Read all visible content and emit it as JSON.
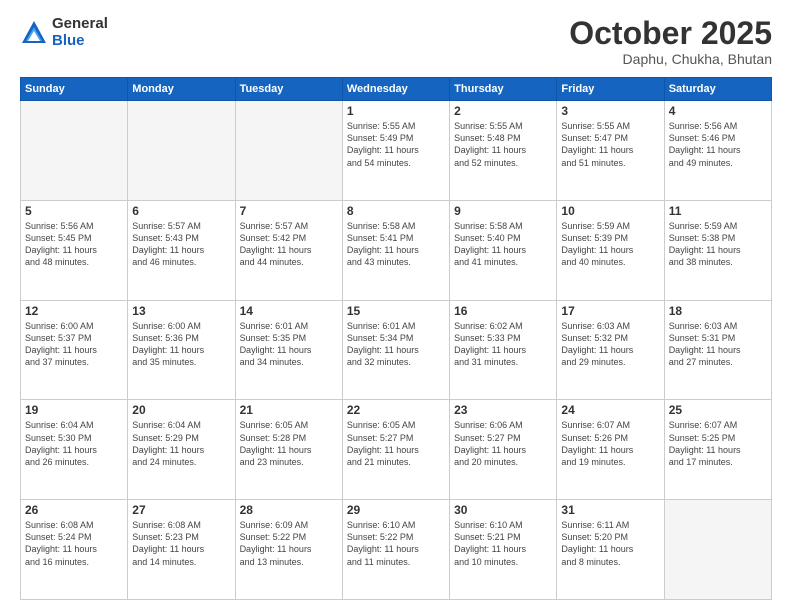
{
  "header": {
    "logo_general": "General",
    "logo_blue": "Blue",
    "title": "October 2025",
    "subtitle": "Daphu, Chukha, Bhutan"
  },
  "weekdays": [
    "Sunday",
    "Monday",
    "Tuesday",
    "Wednesday",
    "Thursday",
    "Friday",
    "Saturday"
  ],
  "weeks": [
    [
      {
        "day": "",
        "info": ""
      },
      {
        "day": "",
        "info": ""
      },
      {
        "day": "",
        "info": ""
      },
      {
        "day": "1",
        "info": "Sunrise: 5:55 AM\nSunset: 5:49 PM\nDaylight: 11 hours\nand 54 minutes."
      },
      {
        "day": "2",
        "info": "Sunrise: 5:55 AM\nSunset: 5:48 PM\nDaylight: 11 hours\nand 52 minutes."
      },
      {
        "day": "3",
        "info": "Sunrise: 5:55 AM\nSunset: 5:47 PM\nDaylight: 11 hours\nand 51 minutes."
      },
      {
        "day": "4",
        "info": "Sunrise: 5:56 AM\nSunset: 5:46 PM\nDaylight: 11 hours\nand 49 minutes."
      }
    ],
    [
      {
        "day": "5",
        "info": "Sunrise: 5:56 AM\nSunset: 5:45 PM\nDaylight: 11 hours\nand 48 minutes."
      },
      {
        "day": "6",
        "info": "Sunrise: 5:57 AM\nSunset: 5:43 PM\nDaylight: 11 hours\nand 46 minutes."
      },
      {
        "day": "7",
        "info": "Sunrise: 5:57 AM\nSunset: 5:42 PM\nDaylight: 11 hours\nand 44 minutes."
      },
      {
        "day": "8",
        "info": "Sunrise: 5:58 AM\nSunset: 5:41 PM\nDaylight: 11 hours\nand 43 minutes."
      },
      {
        "day": "9",
        "info": "Sunrise: 5:58 AM\nSunset: 5:40 PM\nDaylight: 11 hours\nand 41 minutes."
      },
      {
        "day": "10",
        "info": "Sunrise: 5:59 AM\nSunset: 5:39 PM\nDaylight: 11 hours\nand 40 minutes."
      },
      {
        "day": "11",
        "info": "Sunrise: 5:59 AM\nSunset: 5:38 PM\nDaylight: 11 hours\nand 38 minutes."
      }
    ],
    [
      {
        "day": "12",
        "info": "Sunrise: 6:00 AM\nSunset: 5:37 PM\nDaylight: 11 hours\nand 37 minutes."
      },
      {
        "day": "13",
        "info": "Sunrise: 6:00 AM\nSunset: 5:36 PM\nDaylight: 11 hours\nand 35 minutes."
      },
      {
        "day": "14",
        "info": "Sunrise: 6:01 AM\nSunset: 5:35 PM\nDaylight: 11 hours\nand 34 minutes."
      },
      {
        "day": "15",
        "info": "Sunrise: 6:01 AM\nSunset: 5:34 PM\nDaylight: 11 hours\nand 32 minutes."
      },
      {
        "day": "16",
        "info": "Sunrise: 6:02 AM\nSunset: 5:33 PM\nDaylight: 11 hours\nand 31 minutes."
      },
      {
        "day": "17",
        "info": "Sunrise: 6:03 AM\nSunset: 5:32 PM\nDaylight: 11 hours\nand 29 minutes."
      },
      {
        "day": "18",
        "info": "Sunrise: 6:03 AM\nSunset: 5:31 PM\nDaylight: 11 hours\nand 27 minutes."
      }
    ],
    [
      {
        "day": "19",
        "info": "Sunrise: 6:04 AM\nSunset: 5:30 PM\nDaylight: 11 hours\nand 26 minutes."
      },
      {
        "day": "20",
        "info": "Sunrise: 6:04 AM\nSunset: 5:29 PM\nDaylight: 11 hours\nand 24 minutes."
      },
      {
        "day": "21",
        "info": "Sunrise: 6:05 AM\nSunset: 5:28 PM\nDaylight: 11 hours\nand 23 minutes."
      },
      {
        "day": "22",
        "info": "Sunrise: 6:05 AM\nSunset: 5:27 PM\nDaylight: 11 hours\nand 21 minutes."
      },
      {
        "day": "23",
        "info": "Sunrise: 6:06 AM\nSunset: 5:27 PM\nDaylight: 11 hours\nand 20 minutes."
      },
      {
        "day": "24",
        "info": "Sunrise: 6:07 AM\nSunset: 5:26 PM\nDaylight: 11 hours\nand 19 minutes."
      },
      {
        "day": "25",
        "info": "Sunrise: 6:07 AM\nSunset: 5:25 PM\nDaylight: 11 hours\nand 17 minutes."
      }
    ],
    [
      {
        "day": "26",
        "info": "Sunrise: 6:08 AM\nSunset: 5:24 PM\nDaylight: 11 hours\nand 16 minutes."
      },
      {
        "day": "27",
        "info": "Sunrise: 6:08 AM\nSunset: 5:23 PM\nDaylight: 11 hours\nand 14 minutes."
      },
      {
        "day": "28",
        "info": "Sunrise: 6:09 AM\nSunset: 5:22 PM\nDaylight: 11 hours\nand 13 minutes."
      },
      {
        "day": "29",
        "info": "Sunrise: 6:10 AM\nSunset: 5:22 PM\nDaylight: 11 hours\nand 11 minutes."
      },
      {
        "day": "30",
        "info": "Sunrise: 6:10 AM\nSunset: 5:21 PM\nDaylight: 11 hours\nand 10 minutes."
      },
      {
        "day": "31",
        "info": "Sunrise: 6:11 AM\nSunset: 5:20 PM\nDaylight: 11 hours\nand 8 minutes."
      },
      {
        "day": "",
        "info": ""
      }
    ]
  ]
}
